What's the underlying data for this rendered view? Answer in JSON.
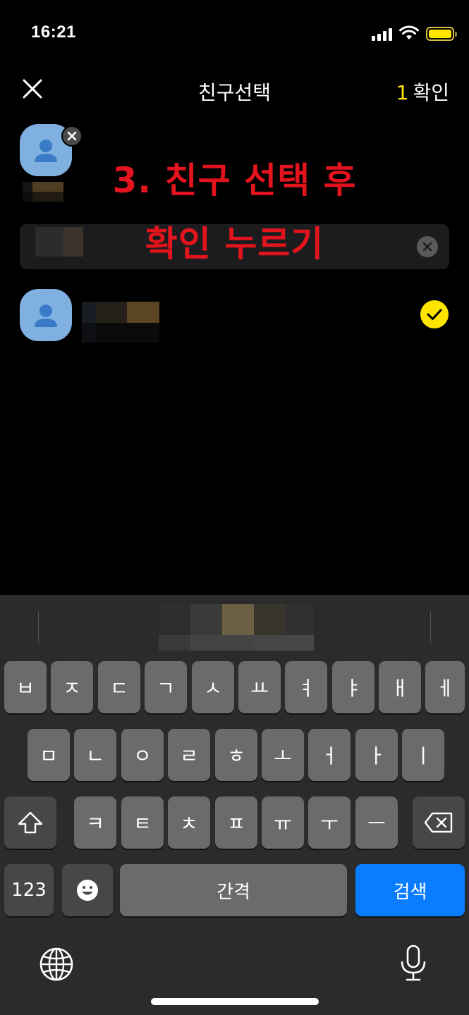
{
  "status_bar": {
    "time": "16:21"
  },
  "header": {
    "title": "친구선택",
    "confirm_count": "1",
    "confirm_label": "확인"
  },
  "selected": {
    "chips": [
      {
        "name": "",
        "avatar": "person-icon"
      }
    ]
  },
  "search": {
    "value": "",
    "clear_icon": "clear-icon"
  },
  "annotation": {
    "line1": "3. 친구 선택 후",
    "line2": "확인 누르기",
    "color": "#e3141d"
  },
  "friends": [
    {
      "name": "",
      "selected": true
    }
  ],
  "keyboard": {
    "row1": [
      "ㅂ",
      "ㅈ",
      "ㄷ",
      "ㄱ",
      "ㅅ",
      "ㅛ",
      "ㅕ",
      "ㅑ",
      "ㅐ",
      "ㅔ"
    ],
    "row2": [
      "ㅁ",
      "ㄴ",
      "ㅇ",
      "ㄹ",
      "ㅎ",
      "ㅗ",
      "ㅓ",
      "ㅏ",
      "ㅣ"
    ],
    "row3": [
      "ㅋ",
      "ㅌ",
      "ㅊ",
      "ㅍ",
      "ㅠ",
      "ㅜ",
      "ㅡ"
    ],
    "numbers_label": "123",
    "space_label": "간격",
    "search_label": "검색"
  },
  "colors": {
    "accent_yellow": "#fee500",
    "keyboard_blue": "#0a7cff",
    "avatar_blue": "#7fb0e0"
  }
}
